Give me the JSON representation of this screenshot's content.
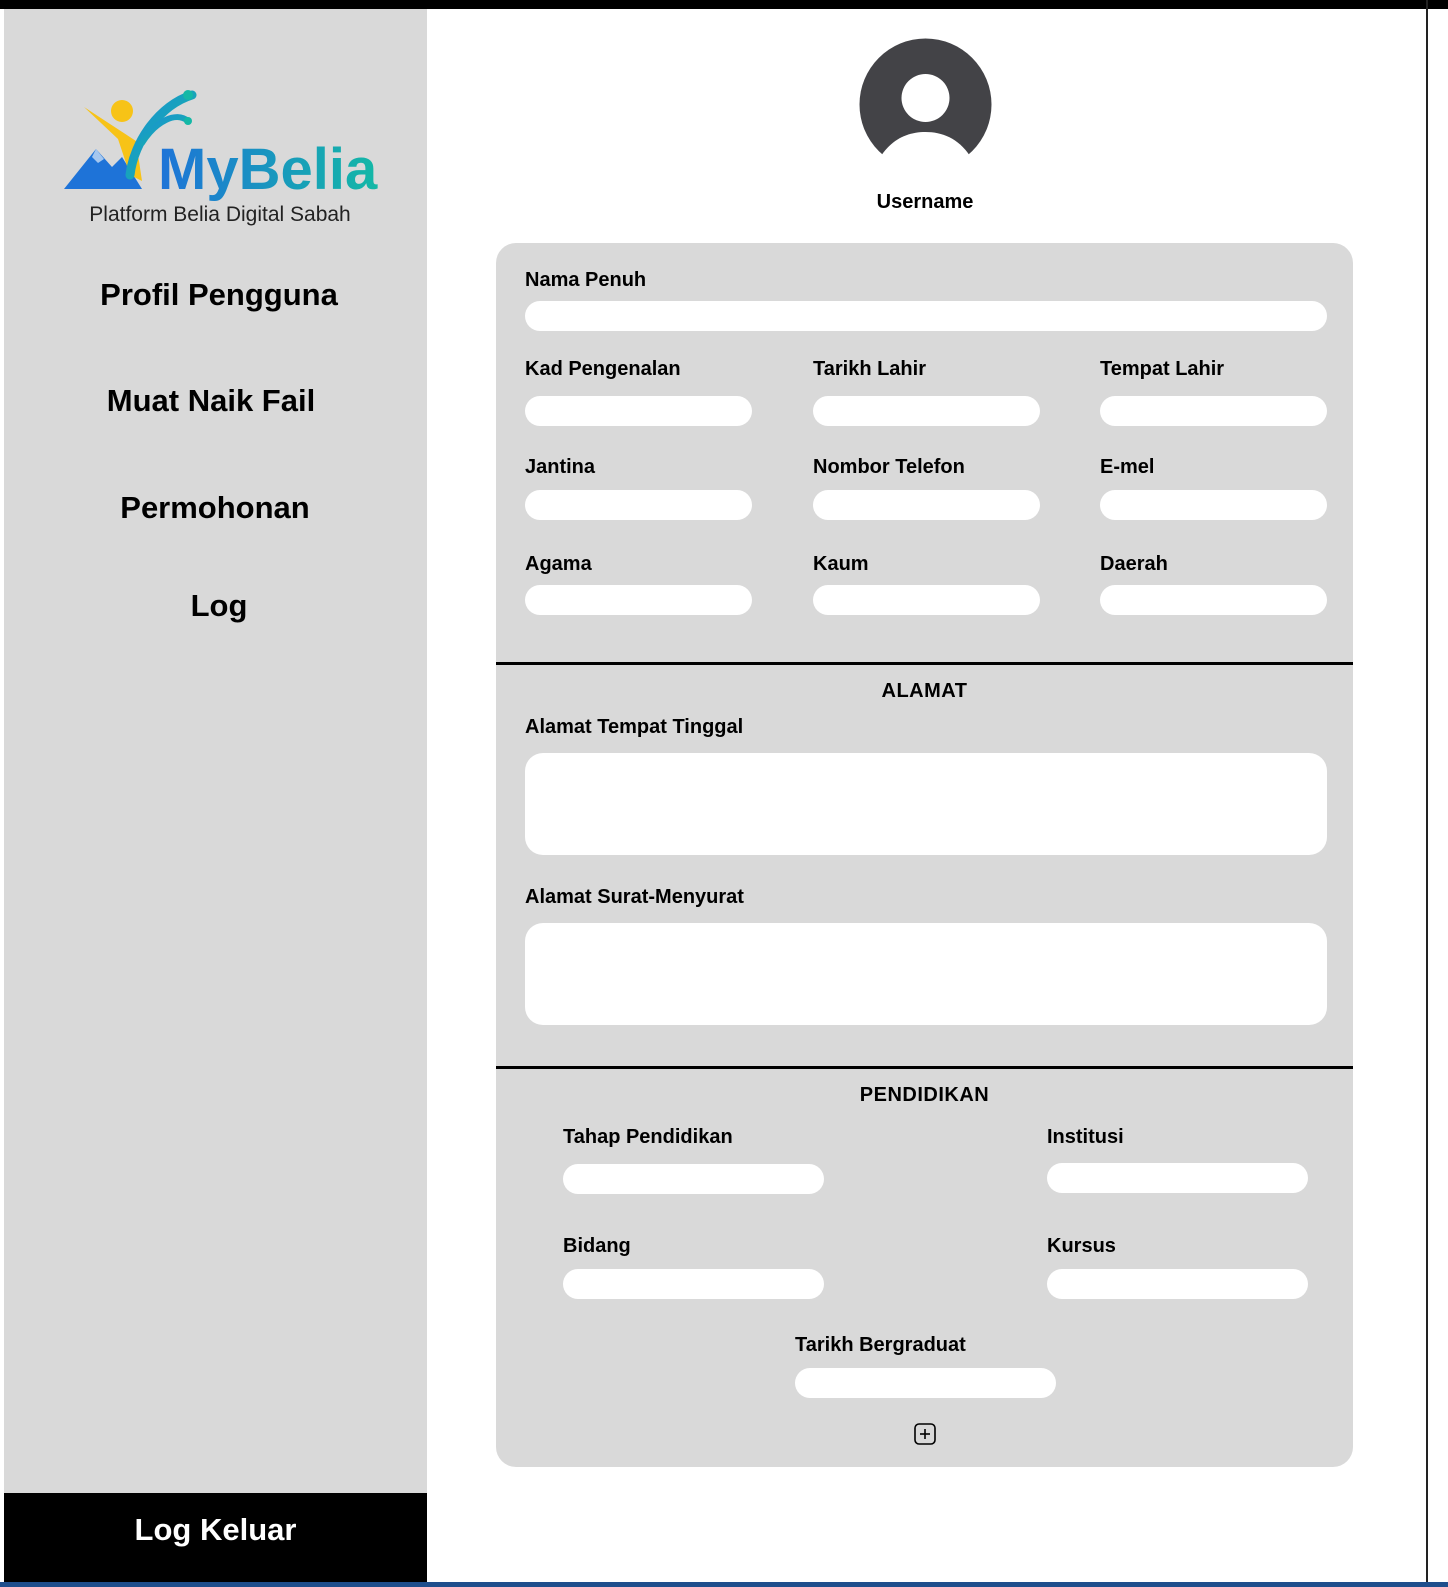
{
  "sidebar": {
    "logo_text": "MyBelia",
    "logo_tagline": "Platform Belia Digital Sabah",
    "nav": [
      "Profil Pengguna",
      "Muat Naik Fail",
      "Permohonan",
      "Log"
    ],
    "logout_label": "Log Keluar"
  },
  "profile": {
    "avatar_icon": "user-avatar-icon",
    "username": "Username"
  },
  "form": {
    "nama_penuh": "Nama Penuh",
    "kad_pengenalan": "Kad Pengenalan",
    "tarikh_lahir": "Tarikh Lahir",
    "tempat_lahir": "Tempat Lahir",
    "jantina": "Jantina",
    "nombor_telefon": "Nombor Telefon",
    "emel": "E-mel",
    "agama": "Agama",
    "kaum": "Kaum",
    "daerah": "Daerah"
  },
  "alamat": {
    "title": "ALAMAT",
    "tempat_tinggal": "Alamat Tempat Tinggal",
    "surat_menyurat": "Alamat Surat-Menyurat"
  },
  "pendidikan": {
    "title": "PENDIDIKAN",
    "tahap": "Tahap Pendidikan",
    "institusi": "Institusi",
    "bidang": "Bidang",
    "kursus": "Kursus",
    "tarikh_bergraduat": "Tarikh Bergraduat",
    "add_icon": "plus-square-icon"
  },
  "colors": {
    "sidebar_bg": "#d9d9d9",
    "card_bg": "#d9d9d9",
    "logout_bg": "#000000",
    "avatar": "#434347",
    "logo_teal": "#14a3b8",
    "logo_blue": "#1e73d8",
    "logo_yellow": "#f7c317"
  }
}
